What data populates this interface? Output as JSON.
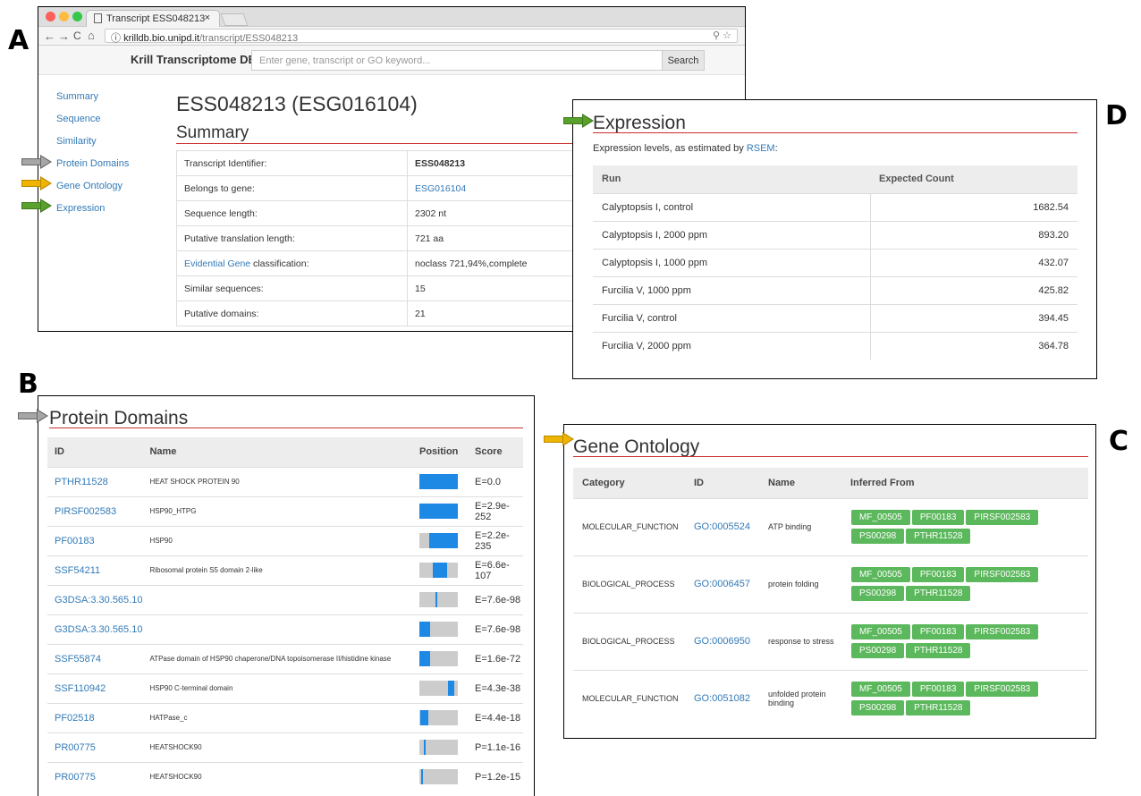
{
  "panels": {
    "a": "A",
    "b": "B",
    "c": "C",
    "d": "D"
  },
  "browser": {
    "tab_title": "Transcript ESS048213",
    "tab_close": "×",
    "url_host": "krilldb.bio.unipd.it",
    "url_path": "/transcript/ESS048213",
    "url_right_icons": "⚲ ☆",
    "nav_back": "←",
    "nav_forward": "→",
    "nav_reload": "C",
    "nav_home": "⌂",
    "nav_info": "ⓘ"
  },
  "site": {
    "brand": "Krill Transcriptome DB",
    "search_placeholder": "Enter gene, transcript or GO keyword...",
    "search_button": "Search"
  },
  "sidebar": {
    "items": [
      {
        "label": "Summary"
      },
      {
        "label": "Sequence"
      },
      {
        "label": "Similarity"
      },
      {
        "label": "Protein Domains"
      },
      {
        "label": "Gene Ontology"
      },
      {
        "label": "Expression"
      }
    ]
  },
  "page": {
    "title": "ESS048213 (ESG016104)",
    "summary_title": "Summary",
    "summary_rows": [
      {
        "key": "Transcript Identifier:",
        "value": "ESS048213"
      },
      {
        "key": "Belongs to gene:",
        "value": "ESG016104"
      },
      {
        "key": "Sequence length:",
        "value": "2302 nt"
      },
      {
        "key": "Putative translation length:",
        "value": "721 aa"
      },
      {
        "key_link": "Evidential Gene",
        "key_rest": " classification:",
        "value": "noclass 721,94%,complete"
      },
      {
        "key": "Similar sequences:",
        "value": "15"
      },
      {
        "key": "Putative domains:",
        "value": "21"
      }
    ]
  },
  "expression": {
    "title": "Expression",
    "intro_text": "Expression levels, as estimated by ",
    "intro_link": "RSEM",
    "intro_end": ":",
    "headers": [
      "Run",
      "Expected Count"
    ],
    "rows": [
      {
        "run": "Calyptopsis I, control",
        "count": "1682.54"
      },
      {
        "run": "Calyptopsis I, 2000 ppm",
        "count": "893.20"
      },
      {
        "run": "Calyptopsis I, 1000 ppm",
        "count": "432.07"
      },
      {
        "run": "Furcilia V, 1000 ppm",
        "count": "425.82"
      },
      {
        "run": "Furcilia V, control",
        "count": "394.45"
      },
      {
        "run": "Furcilia V, 2000 ppm",
        "count": "364.78"
      }
    ]
  },
  "protein_domains": {
    "title": "Protein Domains",
    "headers": [
      "ID",
      "Name",
      "Position",
      "Score"
    ],
    "rows": [
      {
        "id": "PTHR11528",
        "name": "HEAT SHOCK PROTEIN 90",
        "start": 0.0,
        "end": 1.0,
        "score": "E=0.0"
      },
      {
        "id": "PIRSF002583",
        "name": "HSP90_HTPG",
        "start": 0.0,
        "end": 1.0,
        "score": "E=2.9e-252"
      },
      {
        "id": "PF00183",
        "name": "HSP90",
        "start": 0.25,
        "end": 1.0,
        "score": "E=2.2e-235"
      },
      {
        "id": "SSF54211",
        "name": "Ribosomal protein S5 domain 2-like",
        "start": 0.35,
        "end": 0.72,
        "score": "E=6.6e-107"
      },
      {
        "id": "G3DSA:3.30.565.10",
        "name": "",
        "start": 0.42,
        "end": 0.47,
        "score": "E=7.6e-98"
      },
      {
        "id": "G3DSA:3.30.565.10",
        "name": "",
        "start": 0.0,
        "end": 0.28,
        "score": "E=7.6e-98"
      },
      {
        "id": "SSF55874",
        "name": "ATPase domain of HSP90 chaperone/DNA topoisomerase II/histidine kinase",
        "start": 0.0,
        "end": 0.28,
        "score": "E=1.6e-72"
      },
      {
        "id": "SSF110942",
        "name": "HSP90 C-terminal domain",
        "start": 0.74,
        "end": 0.9,
        "score": "E=4.3e-38"
      },
      {
        "id": "PF02518",
        "name": "HATPase_c",
        "start": 0.02,
        "end": 0.23,
        "score": "E=4.4e-18"
      },
      {
        "id": "PR00775",
        "name": "HEATSHOCK90",
        "start": 0.12,
        "end": 0.16,
        "score": "P=1.1e-16"
      },
      {
        "id": "PR00775",
        "name": "HEATSHOCK90",
        "start": 0.05,
        "end": 0.08,
        "score": "P=1.2e-15"
      }
    ]
  },
  "gene_ontology": {
    "title": "Gene Ontology",
    "headers": [
      "Category",
      "ID",
      "Name",
      "Inferred From"
    ],
    "rows": [
      {
        "category": "MOLECULAR_FUNCTION",
        "id": "GO:0005524",
        "name": "ATP binding",
        "tags": [
          "MF_00505",
          "PF00183",
          "PIRSF002583",
          "PS00298",
          "PTHR11528"
        ]
      },
      {
        "category": "BIOLOGICAL_PROCESS",
        "id": "GO:0006457",
        "name": "protein folding",
        "tags": [
          "MF_00505",
          "PF00183",
          "PIRSF002583",
          "PS00298",
          "PTHR11528"
        ]
      },
      {
        "category": "BIOLOGICAL_PROCESS",
        "id": "GO:0006950",
        "name": "response to stress",
        "tags": [
          "MF_00505",
          "PF00183",
          "PIRSF002583",
          "PS00298",
          "PTHR11528"
        ]
      },
      {
        "category": "MOLECULAR_FUNCTION",
        "id": "GO:0051082",
        "name": "unfolded protein binding",
        "tags": [
          "MF_00505",
          "PF00183",
          "PIRSF002583",
          "PS00298",
          "PTHR11528"
        ]
      }
    ]
  },
  "colors": {
    "link": "#337ab7",
    "accent_line": "#c9302c",
    "tag_green": "#5cb85c",
    "position_bar": "#1e88e5"
  }
}
